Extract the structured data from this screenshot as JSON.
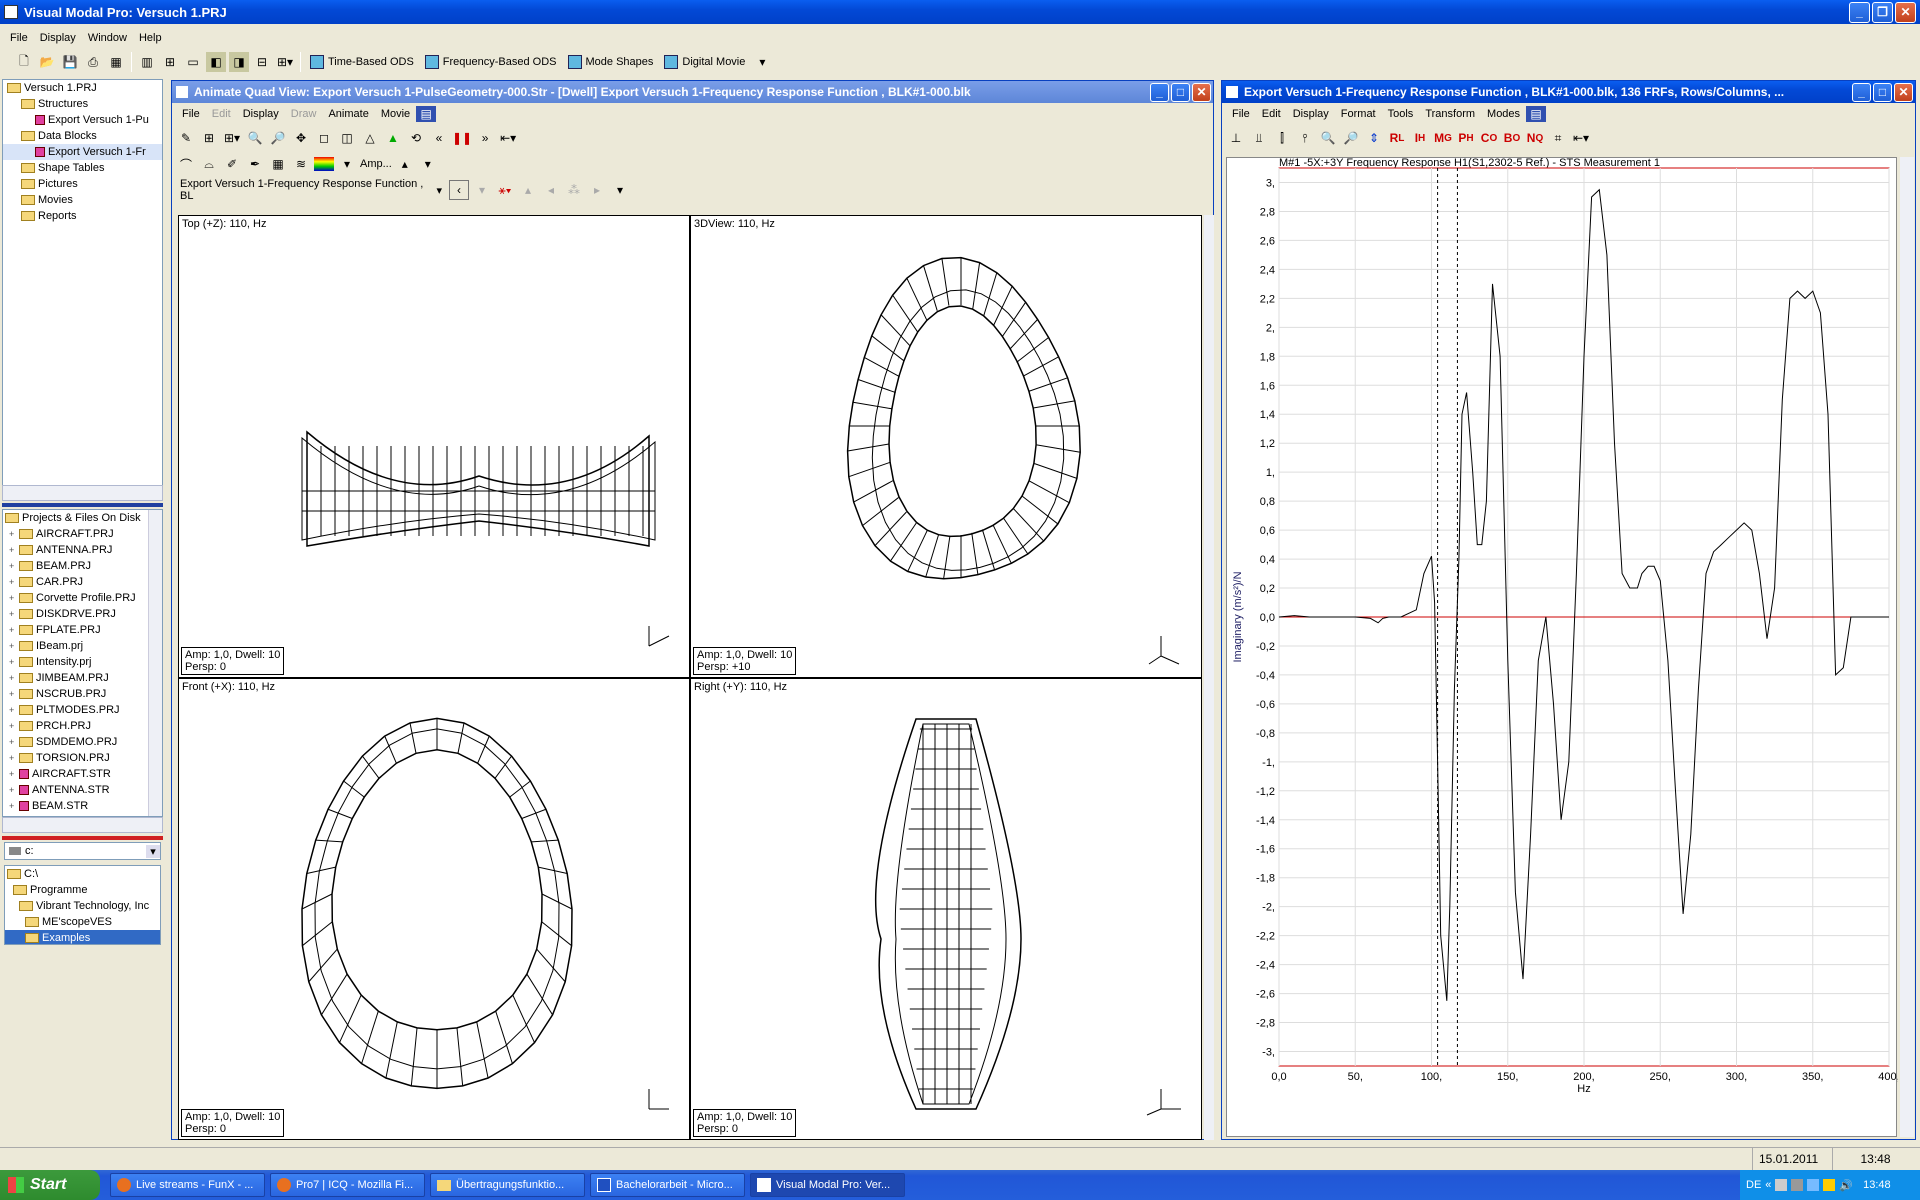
{
  "app": {
    "title": "Visual Modal Pro: Versuch 1.PRJ",
    "menu": [
      "File",
      "Display",
      "Window",
      "Help"
    ],
    "toolbar_buttons": [
      "Time-Based ODS",
      "Frequency-Based ODS",
      "Mode Shapes",
      "Digital Movie"
    ]
  },
  "project_tree": {
    "items": [
      {
        "label": "Versuch 1.PRJ",
        "indent": 0
      },
      {
        "label": "Structures",
        "indent": 1
      },
      {
        "label": "Export Versuch 1-Pu",
        "indent": 2
      },
      {
        "label": "Data Blocks",
        "indent": 1
      },
      {
        "label": "Export Versuch 1-Fr",
        "indent": 2
      },
      {
        "label": "Shape Tables",
        "indent": 1
      },
      {
        "label": "Pictures",
        "indent": 1
      },
      {
        "label": "Movies",
        "indent": 1
      },
      {
        "label": "Reports",
        "indent": 1
      }
    ]
  },
  "files_panel": {
    "title": "Projects & Files On Disk",
    "items": [
      "AIRCRAFT.PRJ",
      "ANTENNA.PRJ",
      "BEAM.PRJ",
      "CAR.PRJ",
      "Corvette Profile.PRJ",
      "DISKDRVE.PRJ",
      "FPLATE.PRJ",
      "IBeam.prj",
      "Intensity.prj",
      "JIMBEAM.PRJ",
      "NSCRUB.PRJ",
      "PLTMODES.PRJ",
      "PRCH.PRJ",
      "SDMDEMO.PRJ",
      "TORSION.PRJ",
      "AIRCRAFT.STR",
      "ANTENNA.STR",
      "BEAM.STR"
    ]
  },
  "drive": {
    "selected": "c:",
    "items": [
      "C:\\",
      "Programme",
      "Vibrant Technology, Inc",
      "ME'scopeVES",
      "Examples"
    ]
  },
  "animate_window": {
    "title": "Animate Quad View: Export Versuch 1-PulseGeometry-000.Str - [Dwell] Export Versuch 1-Frequency Response Function , BLK#1-000.blk",
    "menu": [
      "File",
      "Edit",
      "Display",
      "Draw",
      "Animate",
      "Movie"
    ],
    "amp_label": "Amp...",
    "dropdown": "Export Versuch 1-Frequency Response Function , BL",
    "views": [
      {
        "label": "Top (+Z): 110, Hz",
        "amp": "Amp: 1,0,  Dwell: 10",
        "persp": "Persp: 0"
      },
      {
        "label": "3DView: 110, Hz",
        "amp": "Amp: 1,0,  Dwell: 10",
        "persp": "Persp: +10"
      },
      {
        "label": "Front (+X): 110, Hz",
        "amp": "Amp: 1,0,  Dwell: 10",
        "persp": "Persp: 0"
      },
      {
        "label": "Right (+Y): 110, Hz",
        "amp": "Amp: 1,0,  Dwell: 10",
        "persp": "Persp: 0"
      }
    ]
  },
  "frf_window": {
    "title": "Export Versuch 1-Frequency Response Function , BLK#1-000.blk, 136 FRFs, Rows/Columns, ...",
    "menu": [
      "File",
      "Edit",
      "Display",
      "Format",
      "Tools",
      "Transform",
      "Modes"
    ]
  },
  "chart_data": {
    "type": "line",
    "title": "M#1 -5X:+3Y Frequency Response H1(S1,2302-5 Ref.) - STS Measurement 1",
    "xlabel": "Hz",
    "ylabel": "Imaginary (m/s²)/N",
    "xlim": [
      0,
      400
    ],
    "ylim": [
      -3.1,
      3.1
    ],
    "xticks": [
      "0,0",
      "50,",
      "100,",
      "150,",
      "200,",
      "250,",
      "300,",
      "350,",
      "400,"
    ],
    "yticks": [
      "3,",
      "2,8",
      "2,6",
      "2,4",
      "2,2",
      "2,",
      "1,8",
      "1,6",
      "1,4",
      "1,2",
      "1,",
      "0,8",
      "0,6",
      "0,4",
      "0,2",
      "0,0",
      "-0,2",
      "-0,4",
      "-0,6",
      "-0,8",
      "-1,",
      "-1,2",
      "-1,4",
      "-1,6",
      "-1,8",
      "-2,",
      "-2,2",
      "-2,4",
      "-2,6",
      "-2,8",
      "-3,"
    ],
    "cursors_hz": [
      104,
      117
    ],
    "series": [
      {
        "x": [
          0,
          10,
          20,
          30,
          40,
          50,
          60,
          65,
          68,
          72,
          80,
          90,
          95,
          100,
          102,
          104,
          106,
          110,
          112,
          115,
          118,
          120,
          123,
          127,
          130,
          133,
          136,
          140,
          145,
          150,
          155,
          160,
          165,
          170,
          175,
          180,
          185,
          190,
          195,
          200,
          205,
          210,
          215,
          220,
          225,
          230,
          235,
          238,
          242,
          246,
          250,
          255,
          260,
          265,
          270,
          275,
          280,
          285,
          290,
          295,
          300,
          305,
          310,
          315,
          320,
          325,
          330,
          335,
          340,
          345,
          350,
          355,
          360,
          365,
          370,
          375,
          380,
          385,
          390,
          395,
          400
        ],
        "y": [
          0,
          0.01,
          0,
          0,
          0,
          0,
          -0.01,
          -0.04,
          -0.01,
          0,
          0,
          0.05,
          0.3,
          0.42,
          0.1,
          -1.0,
          -2.2,
          -2.65,
          -2.0,
          -0.5,
          0.4,
          1.4,
          1.55,
          1.0,
          0.5,
          0.5,
          0.8,
          2.3,
          1.8,
          -0.3,
          -1.9,
          -2.5,
          -1.5,
          -0.3,
          0,
          -0.6,
          -1.4,
          -1.0,
          0.3,
          1.8,
          2.9,
          2.95,
          2.5,
          1.2,
          0.3,
          0.2,
          0.2,
          0.3,
          0.35,
          0.35,
          0.25,
          -0.3,
          -1.2,
          -2.05,
          -1.5,
          -0.5,
          0.3,
          0.45,
          0.5,
          0.55,
          0.6,
          0.65,
          0.6,
          0.3,
          -0.15,
          0.2,
          1.5,
          2.2,
          2.25,
          2.2,
          2.25,
          2.1,
          1.4,
          -0.4,
          -0.35,
          0,
          0,
          0,
          0,
          0,
          0
        ]
      }
    ]
  },
  "status": {
    "date": "15.01.2011",
    "time": "13:48"
  },
  "taskbar": {
    "start": "Start",
    "tasks": [
      "Live streams - FunX - ...",
      "Pro7 | ICQ - Mozilla Fi...",
      "Übertragungsfunktio...",
      "Bachelorarbeit - Micro...",
      "Visual Modal Pro: Ver..."
    ],
    "lang": "DE",
    "clock": "13:48"
  }
}
